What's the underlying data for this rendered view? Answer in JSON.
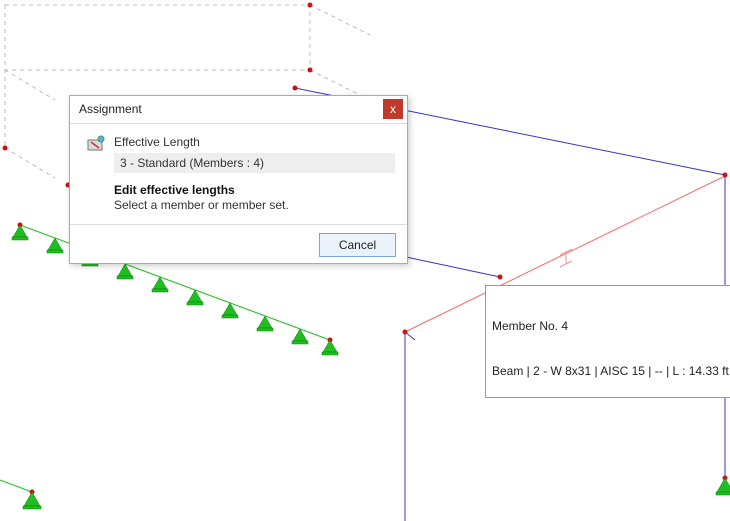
{
  "dialog": {
    "title": "Assignment",
    "close_label": "x",
    "section_title": "Effective Length",
    "selected_item": "3 - Standard (Members : 4)",
    "instruction_title": "Edit effective lengths",
    "instruction_sub": "Select a member or member set.",
    "cancel_label": "Cancel"
  },
  "tooltip": {
    "line1": "Member No. 4",
    "line2": "Beam | 2 - W 8x31 | AISC 15 | -- | L : 14.33 ft"
  },
  "icons": {
    "effective_length": "effective-length-icon",
    "close": "close-icon"
  },
  "colors": {
    "close_bg": "#c0392b",
    "cancel_border": "#7aa7d6",
    "cancel_bg": "#eaf2fb",
    "beam_blue": "#3333cc",
    "selected_beam": "#ff6666",
    "support_green": "#1fbf1f",
    "node_red": "#cc1111",
    "dashed": "#bbbbbb"
  }
}
